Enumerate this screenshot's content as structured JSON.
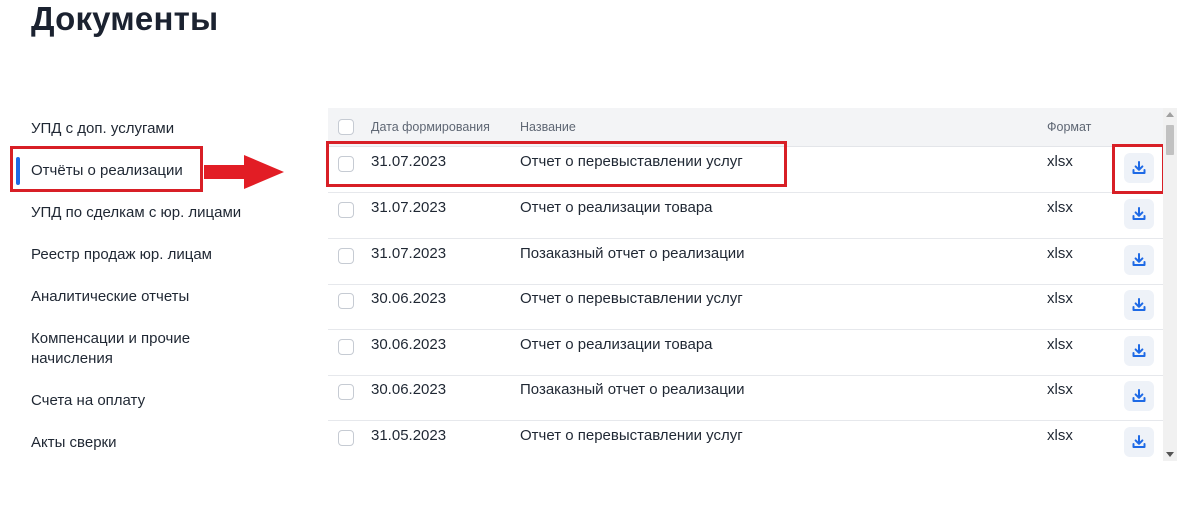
{
  "page": {
    "title": "Документы"
  },
  "sidebar": {
    "active_index": 1,
    "items": [
      {
        "label": "УПД с доп. услугами"
      },
      {
        "label": "Отчёты о реализации"
      },
      {
        "label": "УПД по сделкам с юр. лицами"
      },
      {
        "label": "Реестр продаж юр. лицам"
      },
      {
        "label": "Аналитические отчеты"
      },
      {
        "label": "Компенсации и прочие начисления"
      },
      {
        "label": "Счета на оплату"
      },
      {
        "label": "Акты сверки"
      }
    ]
  },
  "table": {
    "columns": {
      "date": "Дата формирования",
      "name": "Название",
      "format": "Формат"
    },
    "rows": [
      {
        "date": "31.07.2023",
        "name": "Отчет о перевыставлении услуг",
        "format": "xlsx"
      },
      {
        "date": "31.07.2023",
        "name": "Отчет о реализации товара",
        "format": "xlsx"
      },
      {
        "date": "31.07.2023",
        "name": "Позаказный отчет о реализации",
        "format": "xlsx"
      },
      {
        "date": "30.06.2023",
        "name": "Отчет о перевыставлении услуг",
        "format": "xlsx"
      },
      {
        "date": "30.06.2023",
        "name": "Отчет о реализации товара",
        "format": "xlsx"
      },
      {
        "date": "30.06.2023",
        "name": "Позаказный отчет о реализации",
        "format": "xlsx"
      },
      {
        "date": "31.05.2023",
        "name": "Отчет о перевыставлении услуг",
        "format": "xlsx"
      }
    ],
    "row_action_icon": "download-icon"
  },
  "annotations": {
    "color": "#d81f26",
    "arrow_icon": "red-arrow-right"
  },
  "colors": {
    "accent": "#1e6ae6",
    "download_icon": "#1e6ae6",
    "header_bg": "#f3f4f6"
  }
}
